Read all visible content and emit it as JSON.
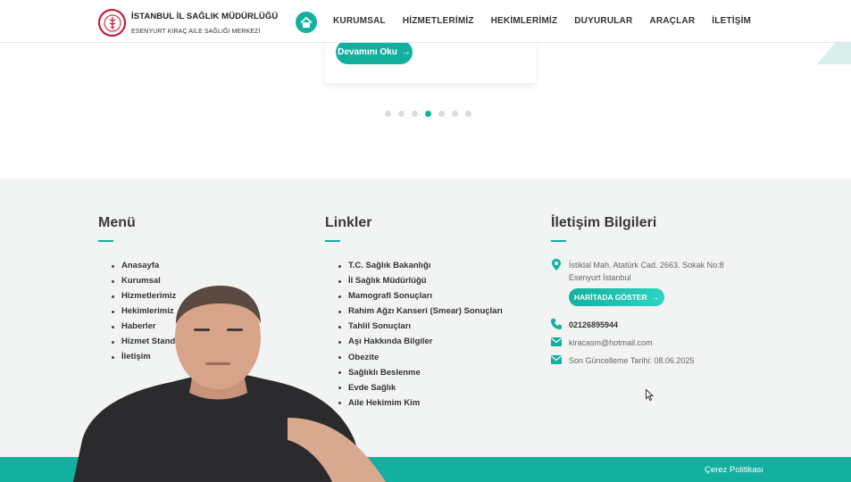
{
  "header": {
    "brand_title": "İSTANBUL İL SAĞLIK MÜDÜRLÜĞÜ",
    "brand_subtitle": "ESENYURT KIRAÇ AILE SAĞLIĞI MERKEZİ",
    "nav": [
      "KURUMSAL",
      "HİZMETLERİMİZ",
      "HEKİMLERİMİZ",
      "DUYURULAR",
      "ARAÇLAR",
      "İLETİŞİM"
    ]
  },
  "hero": {
    "read_more_label": "Devamını Oku",
    "arrow": "→",
    "slide_count": 7,
    "active_slide": 4
  },
  "footer": {
    "menu_title": "Menü",
    "menu_items": [
      "Anasayfa",
      "Kurumsal",
      "Hizmetlerimiz",
      "Hekimlerimiz",
      "Haberler",
      "Hizmet Standartları",
      "İletişim"
    ],
    "links_title": "Linkler",
    "links_items": [
      "T.C. Sağlık Bakanlığı",
      "İl Sağlık Müdürlüğü",
      "Mamografi Sonuçları",
      "Rahim Ağzı Kanseri (Smear) Sonuçları",
      "Tahlil Sonuçları",
      "Aşı Hakkında Bilgiler",
      "Obezite",
      "Sağlıklı Beslenme",
      "Evde Sağlık",
      "Aile Hekimim Kim"
    ],
    "contact_title": "İletişim Bilgileri",
    "address_line1": "İstiklal Mah. Atatürk Cad. 2663. Sokak No:8",
    "address_line2": "Esenyurt İstanbul",
    "map_button": "HARİTADA GÖSTER",
    "phone": "02126895944",
    "email": "kiracasm@hotmail.com",
    "last_update": "Son Güncelleme Tarihi: 08.06.2025",
    "cookie_policy": "Çerez Politikası"
  },
  "colors": {
    "accent": "#13b0a0",
    "brand_red": "#c8102e",
    "footer_bg": "#f2f3f3"
  }
}
